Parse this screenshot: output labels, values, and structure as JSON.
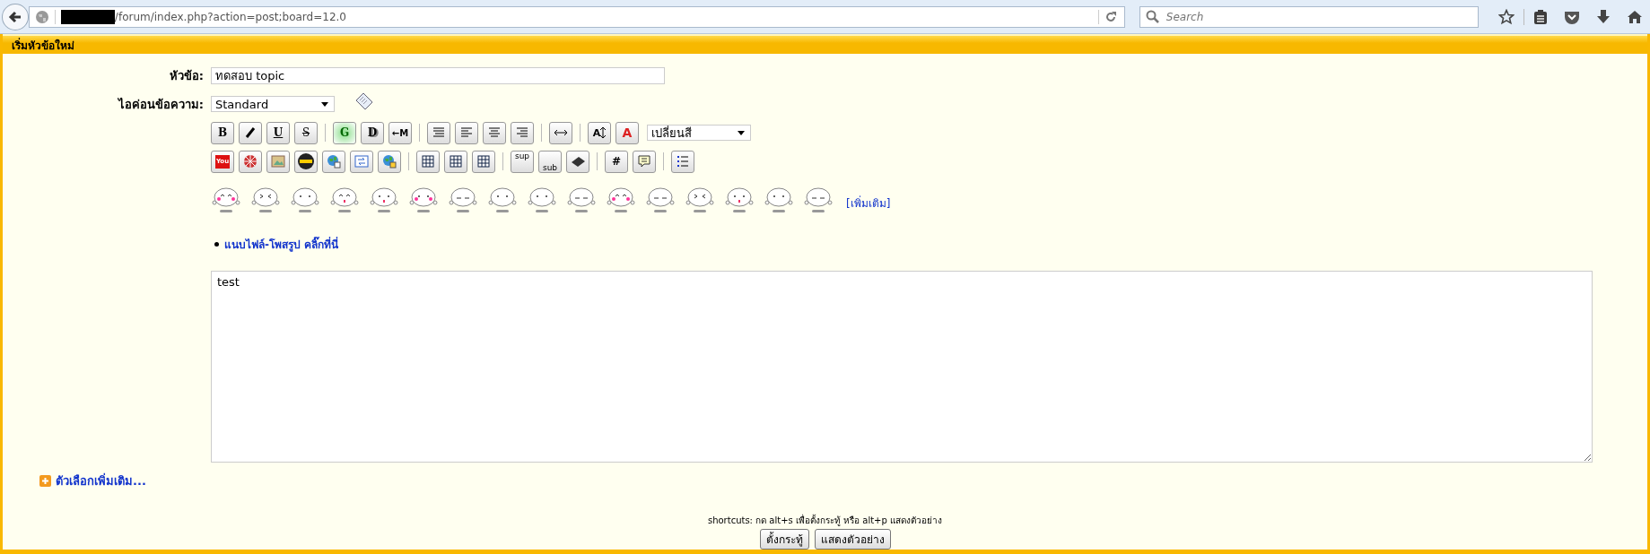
{
  "browser": {
    "url": "/forum/index.php?action=post;board=12.0",
    "search": {
      "placeholder": "Search"
    }
  },
  "header": {
    "title": "เริ่มหัวข้อใหม่"
  },
  "form": {
    "subject": {
      "label": "หัวข้อ:",
      "value": "ทดสอบ topic"
    },
    "message_icon": {
      "label": "ไอค่อนข้อความ:",
      "value": "Standard"
    },
    "toolbar_rows": [
      [
        {
          "kind": "bold",
          "label": "B"
        },
        {
          "kind": "italic"
        },
        {
          "kind": "underline",
          "label": "U"
        },
        {
          "kind": "strike",
          "label": "S"
        },
        {
          "kind": "sep"
        },
        {
          "kind": "glow",
          "label": "G"
        },
        {
          "kind": "shadow",
          "label": "D"
        },
        {
          "kind": "move",
          "label": "←M"
        },
        {
          "kind": "sep"
        },
        {
          "kind": "pre"
        },
        {
          "kind": "left"
        },
        {
          "kind": "center"
        },
        {
          "kind": "right"
        },
        {
          "kind": "sep"
        },
        {
          "kind": "rule"
        },
        {
          "kind": "sep"
        },
        {
          "kind": "size",
          "label": "A"
        },
        {
          "kind": "color",
          "label": "A"
        }
      ],
      [
        {
          "kind": "youtube",
          "label": "You"
        },
        {
          "kind": "flash"
        },
        {
          "kind": "image"
        },
        {
          "kind": "ninja"
        },
        {
          "kind": "globe"
        },
        {
          "kind": "email"
        },
        {
          "kind": "ftp"
        },
        {
          "kind": "sep"
        },
        {
          "kind": "table"
        },
        {
          "kind": "table"
        },
        {
          "kind": "table"
        },
        {
          "kind": "sep"
        },
        {
          "kind": "sup",
          "label": "sup"
        },
        {
          "kind": "sub",
          "label": "sub"
        },
        {
          "kind": "tele"
        },
        {
          "kind": "sep"
        },
        {
          "kind": "code",
          "label": "#"
        },
        {
          "kind": "quote"
        },
        {
          "kind": "sep"
        },
        {
          "kind": "list"
        }
      ]
    ],
    "color_select": {
      "value": "เปลี่ยนสี"
    },
    "more_smileys": "[เพิ่มเติม]",
    "attach_link": "แนบไฟล์-โพสรูป คลิ๊กที่นี่",
    "message": "test",
    "more_options": "ตัวเลือกเพิ่มเติม...",
    "shortcuts": "shortcuts: กด alt+s เพื่อตั้งกระทู้ หรือ alt+p แสดงตัวอย่าง",
    "buttons": [
      "ตั้งกระทู้",
      "แสดงตัวอย่าง"
    ]
  }
}
